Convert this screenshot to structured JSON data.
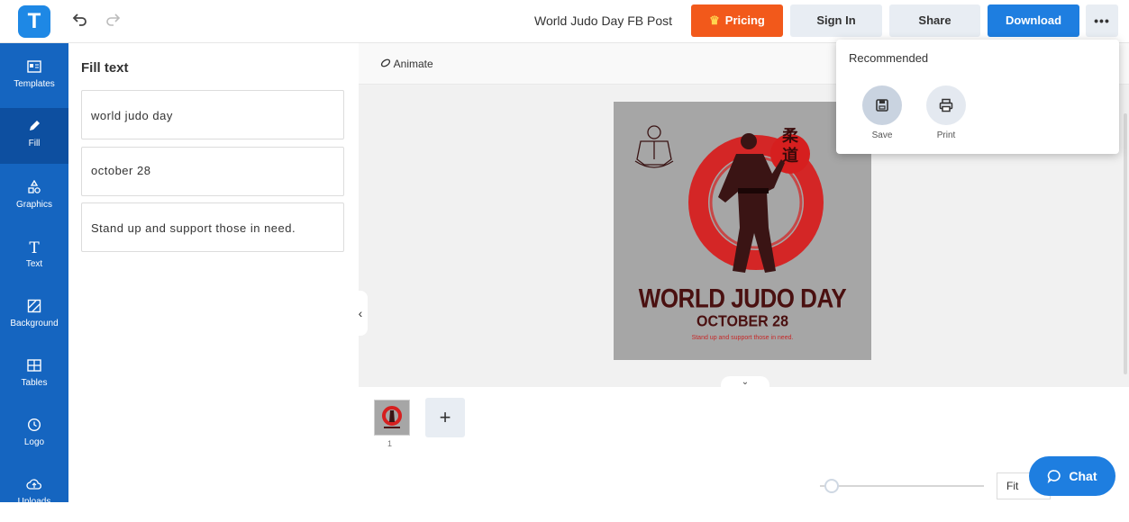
{
  "app": {
    "logo_letter": "T"
  },
  "header": {
    "doc_title": "World Judo Day FB Post",
    "pricing_label": "Pricing",
    "signin_label": "Sign In",
    "share_label": "Share",
    "download_label": "Download",
    "more_label": "•••",
    "undo_icon": "undo-icon",
    "redo_icon": "redo-icon"
  },
  "sidebar": {
    "items": [
      {
        "label": "Templates",
        "icon": "templates-icon"
      },
      {
        "label": "Fill",
        "icon": "pencil-icon",
        "active": true
      },
      {
        "label": "Graphics",
        "icon": "shapes-icon"
      },
      {
        "label": "Text",
        "icon": "text-icon"
      },
      {
        "label": "Background",
        "icon": "background-icon"
      },
      {
        "label": "Tables",
        "icon": "table-icon"
      },
      {
        "label": "Logo",
        "icon": "logo-icon"
      },
      {
        "label": "Uploads",
        "icon": "cloud-upload-icon"
      }
    ]
  },
  "panel": {
    "title": "Fill text",
    "fields": [
      "world judo day",
      "october 28",
      "Stand up and support those in need."
    ]
  },
  "toolbar": {
    "animate_label": "Animate"
  },
  "design": {
    "title": "WORLD JUDO DAY",
    "date": "OCTOBER 28",
    "subtitle": "Stand up and support those in need.",
    "bg_color": "#a6a6a6",
    "accent_color": "#d61f1f",
    "text_color": "#4a1010",
    "kanji": "柔道"
  },
  "pages": {
    "current_number": "1",
    "add_label": "+"
  },
  "zoom": {
    "fit_label": "Fit"
  },
  "chat": {
    "label": "Chat"
  },
  "dropdown": {
    "title": "Recommended",
    "items": [
      {
        "label": "Save",
        "icon": "save-icon"
      },
      {
        "label": "Print",
        "icon": "print-icon"
      }
    ]
  },
  "colors": {
    "primary": "#1e7ee0",
    "sidebar": "#1565c0",
    "pricing": "#f2591b",
    "secondary_btn": "#e8edf3"
  }
}
